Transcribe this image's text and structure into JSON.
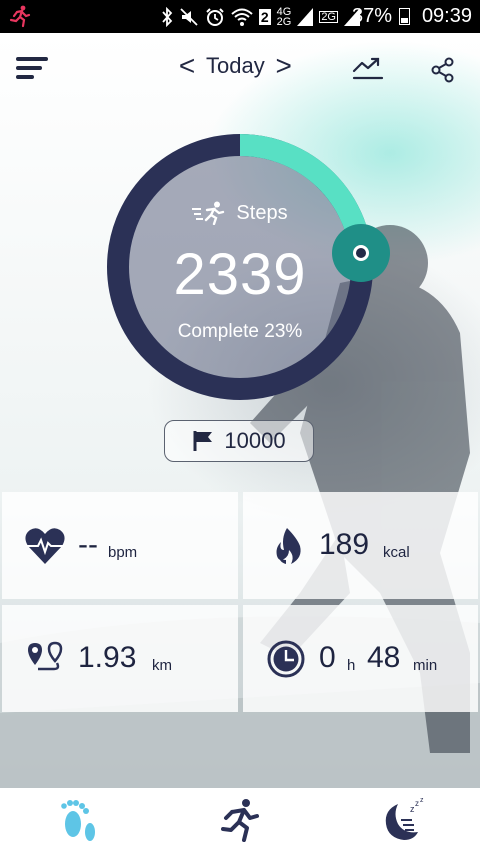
{
  "status_bar": {
    "battery_text": "37%",
    "time": "09:39",
    "sim_badge": "2",
    "net_top": "4G",
    "net_bottom": "2G",
    "net2": "2G"
  },
  "header": {
    "date_label": "Today",
    "prev_symbol": "<",
    "next_symbol": ">"
  },
  "steps": {
    "label": "Steps",
    "value": "2339",
    "complete_text": "Complete 23%",
    "progress": 0.23
  },
  "goal": {
    "value": "10000"
  },
  "stats": {
    "heart": {
      "value": "--",
      "unit": "bpm"
    },
    "calories": {
      "value": "189",
      "unit": "kcal"
    },
    "distance": {
      "value": "1.93",
      "unit": "km"
    },
    "duration": {
      "hours": "0",
      "hours_unit": "h",
      "minutes": "48",
      "minutes_unit": "min"
    }
  },
  "colors": {
    "navy": "#2b3156",
    "teal": "#58e0c4",
    "knob": "#1f8f87",
    "icon_active": "#5ec5e6",
    "icon_dark": "#222842"
  },
  "bottom_nav": [
    "steps-tab",
    "activity-tab",
    "sleep-tab"
  ]
}
